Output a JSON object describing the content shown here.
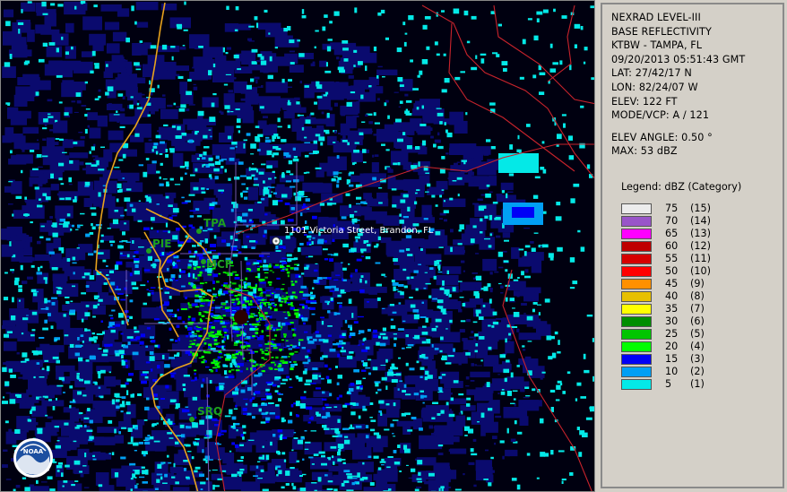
{
  "info_panel": {
    "lines": [
      "NEXRAD LEVEL-III",
      "BASE REFLECTIVITY",
      "KTBW - TAMPA, FL",
      "09/20/2013 05:51:43 GMT",
      "LAT: 27/42/17 N",
      "LON: 82/24/07 W",
      "ELEV: 122 FT",
      "MODE/VCP: A / 121"
    ],
    "lines2": [
      "ELEV ANGLE: 0.50 °",
      "MAX: 53 dBZ"
    ]
  },
  "legend": {
    "title": "Legend: dBZ (Category)",
    "items": [
      {
        "value": "75",
        "category": "(15)",
        "color": "#ececec"
      },
      {
        "value": "70",
        "category": "(14)",
        "color": "#9955c9"
      },
      {
        "value": "65",
        "category": "(13)",
        "color": "#ff00ff"
      },
      {
        "value": "60",
        "category": "(12)",
        "color": "#bf0000"
      },
      {
        "value": "55",
        "category": "(11)",
        "color": "#d60000"
      },
      {
        "value": "50",
        "category": "(10)",
        "color": "#ff0000"
      },
      {
        "value": "45",
        "category": "(9)",
        "color": "#ff9000"
      },
      {
        "value": "40",
        "category": "(8)",
        "color": "#e7c000"
      },
      {
        "value": "35",
        "category": "(7)",
        "color": "#ffff00"
      },
      {
        "value": "30",
        "category": "(6)",
        "color": "#008e00"
      },
      {
        "value": "25",
        "category": "(5)",
        "color": "#01c501"
      },
      {
        "value": "20",
        "category": "(4)",
        "color": "#02fd02"
      },
      {
        "value": "15",
        "category": "(3)",
        "color": "#0000f6"
      },
      {
        "value": "10",
        "category": "(2)",
        "color": "#019ff4"
      },
      {
        "value": "5",
        "category": "(1)",
        "color": "#04e9e7"
      }
    ]
  },
  "map": {
    "marker_label": "1101 Victoria Street, Brandon, FL",
    "stations": [
      "TPA",
      "PIE",
      "MCF",
      "SRQ"
    ],
    "logo_text": "NOAA"
  }
}
